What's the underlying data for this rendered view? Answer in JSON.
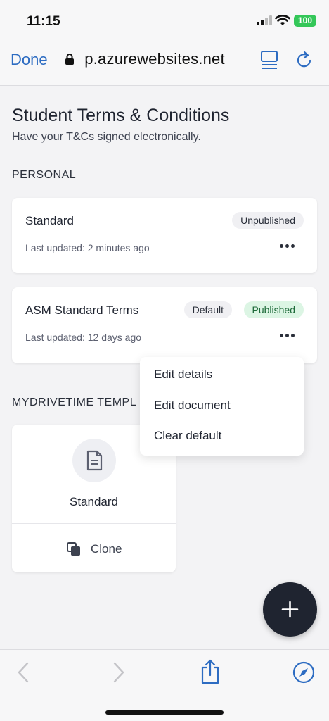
{
  "status_bar": {
    "time": "11:15",
    "battery": "100"
  },
  "browser": {
    "done_label": "Done",
    "url": " p.azurewebsites.net"
  },
  "page": {
    "title": "Student Terms & Conditions",
    "subtitle": "Have your T&Cs signed electronically."
  },
  "personal": {
    "section_label": "PERSONAL",
    "cards": [
      {
        "title": "Standard",
        "meta": "Last updated: 2 minutes ago",
        "status": "Unpublished"
      },
      {
        "title": "ASM Standard Terms",
        "meta": "Last updated: 12 days ago",
        "default_badge": "Default",
        "status": "Published"
      }
    ]
  },
  "menu": {
    "items": [
      "Edit details",
      "Edit document",
      "Clear default"
    ]
  },
  "mydrivetime": {
    "section_label": "MYDRIVETIME TEMPL",
    "template": {
      "title": "Standard",
      "clone_label": "Clone"
    }
  },
  "colors": {
    "accent": "#2d6cc2",
    "published_bg": "#dcf5e4",
    "fab": "#1f2430"
  },
  "icons": [
    "lock-icon",
    "reader-icon",
    "reload-icon",
    "more-icon",
    "document-icon",
    "clone-icon",
    "plus-icon",
    "back-icon",
    "forward-icon",
    "share-icon",
    "compass-icon"
  ]
}
